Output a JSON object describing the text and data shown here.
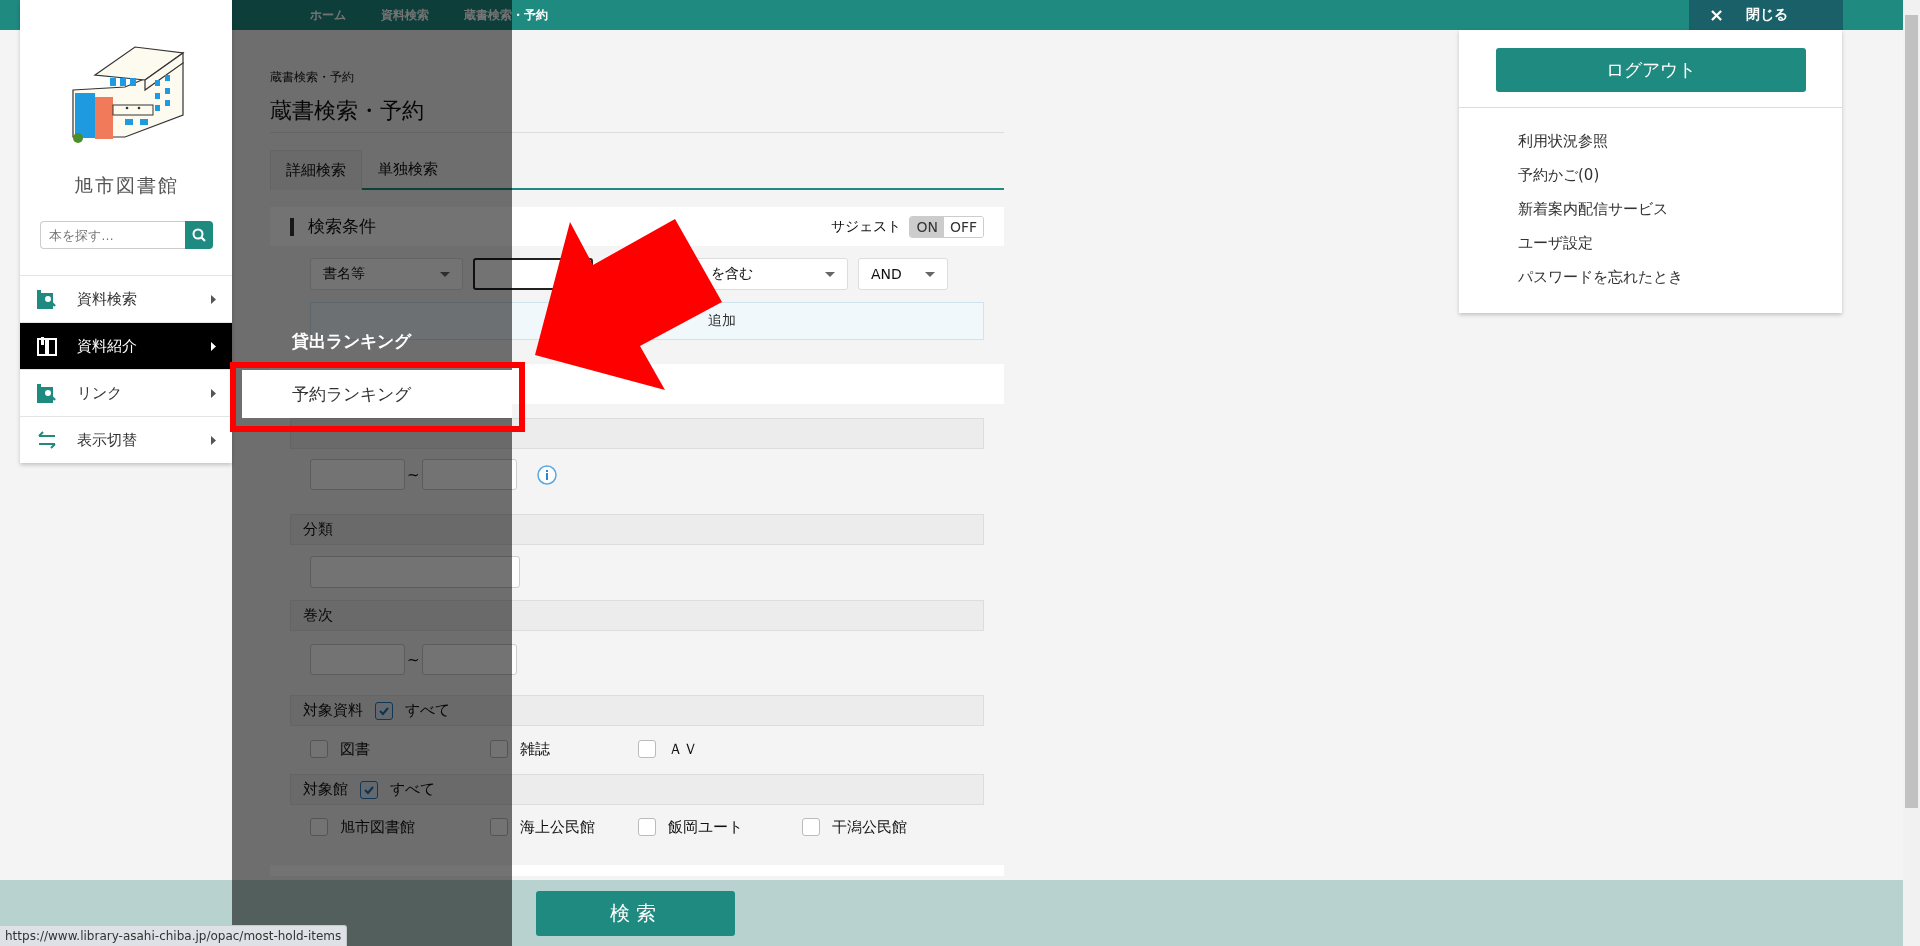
{
  "top_bar": {
    "breadcrumbs": [
      "ホーム",
      "資料検索",
      "蔵書検索・予約"
    ],
    "close_button": {
      "icon": "×",
      "label": "閉じる"
    }
  },
  "side_menu": {
    "library_name": "旭市図書館",
    "search": {
      "placeholder": "本を探す…"
    },
    "items": [
      {
        "label": "資料検索",
        "selected": false
      },
      {
        "label": "資料紹介",
        "selected": true
      },
      {
        "label": "リンク",
        "selected": false
      },
      {
        "label": "表示切替",
        "selected": false
      }
    ],
    "submenu": [
      {
        "label": "貸出ランキング",
        "selected": false
      },
      {
        "label": "予約ランキング",
        "selected": true
      }
    ]
  },
  "page": {
    "breadcrumb": "蔵書検索・予約",
    "title": "蔵書検索・予約",
    "tabs": [
      {
        "label": "詳細検索",
        "selected": true
      },
      {
        "label": "単独検索",
        "selected": false
      }
    ],
    "conditions": {
      "heading": "検索条件",
      "suggest": {
        "label": "サジェスト",
        "options": [
          {
            "label": "ON",
            "selected": true
          },
          {
            "label": "OFF",
            "selected": false
          }
        ]
      },
      "field_select": "書名等",
      "match_select": "を含む",
      "operator_select": "AND",
      "add_row": "追加"
    },
    "filters": [
      {
        "kind": "range",
        "separator": "~",
        "info_icon": true
      },
      {
        "kind": "text",
        "label": "分類"
      },
      {
        "kind": "range",
        "label": "巻次",
        "separator": "~"
      },
      {
        "kind": "checks",
        "label": "対象資料",
        "all": {
          "label": "すべて",
          "checked": true
        },
        "options": [
          {
            "label": "図書",
            "checked": false
          },
          {
            "label": "雑誌",
            "checked": false
          },
          {
            "label": "ＡＶ",
            "checked": false
          }
        ]
      },
      {
        "kind": "checks",
        "label": "対象館",
        "all": {
          "label": "すべて",
          "checked": true
        },
        "options": [
          {
            "label": "旭市図書館",
            "checked": false
          },
          {
            "label": "海上公民館",
            "checked": false
          },
          {
            "label": "飯岡ユート",
            "checked": false
          },
          {
            "label": "干潟公民館",
            "checked": false
          }
        ]
      }
    ]
  },
  "user_panel": {
    "logout": "ログアウト",
    "links": [
      "利用状況参照",
      "予約かご(0)",
      "新着案内配信サービス",
      "ユーザ設定",
      "パスワードを忘れたとき"
    ]
  },
  "search_button": "検索",
  "status_url": "https://www.library-asahi-chiba.jp/opac/most-hold-items"
}
